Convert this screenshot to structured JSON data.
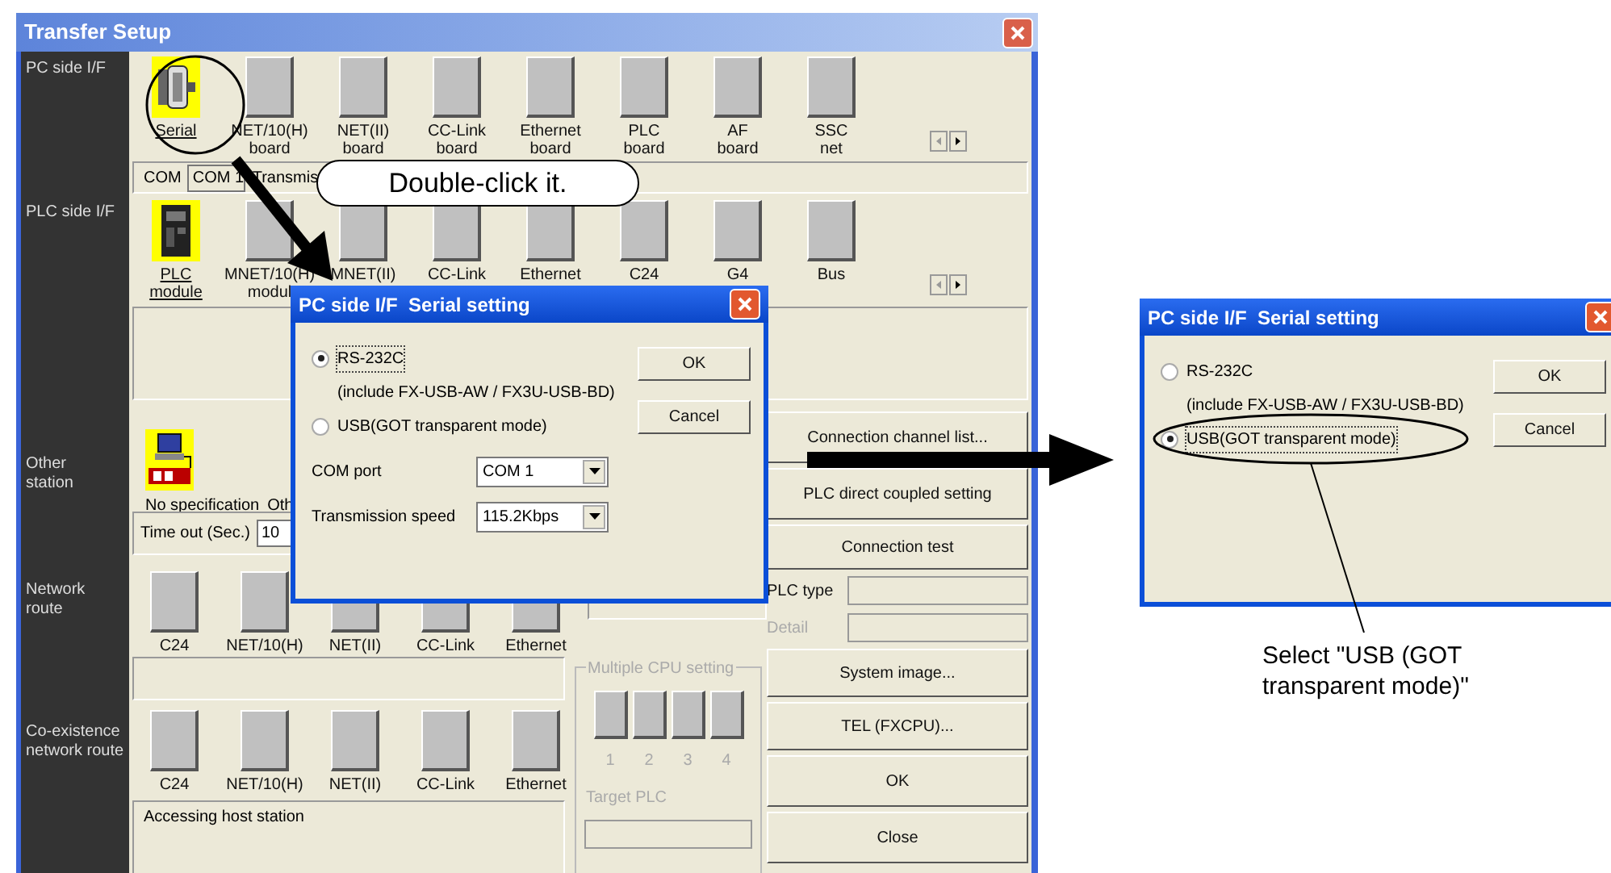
{
  "transfer_setup": {
    "title": "Transfer Setup",
    "pc_side": {
      "label": "PC side I/F",
      "items": [
        {
          "label": "Serial",
          "selected": true
        },
        {
          "label": "NET/10(H)\nboard",
          "selected": false
        },
        {
          "label": "NET(II)\nboard",
          "selected": false
        },
        {
          "label": "CC-Link\nboard",
          "selected": false
        },
        {
          "label": "Ethernet\nboard",
          "selected": false
        },
        {
          "label": "PLC\nboard",
          "selected": false
        },
        {
          "label": "AF\nboard",
          "selected": false
        },
        {
          "label": "SSC\nnet",
          "selected": false
        }
      ]
    },
    "com_bar": {
      "label": "COM",
      "value": "COM 1",
      "text": "Transmis"
    },
    "plc_side": {
      "label": "PLC side I/F",
      "items": [
        {
          "label": "PLC\nmodule",
          "selected": true
        },
        {
          "label": "MNET/10(H)\nmodul",
          "selected": false
        },
        {
          "label": "MNET(II)",
          "selected": false
        },
        {
          "label": "CC-Link",
          "selected": false
        },
        {
          "label": "Ethernet",
          "selected": false
        },
        {
          "label": "C24",
          "selected": false
        },
        {
          "label": "G4",
          "selected": false
        },
        {
          "label": "Bus",
          "selected": false
        }
      ]
    },
    "other_station": {
      "label": "Other\nstation",
      "item": {
        "label": "No specification",
        "selected": true
      },
      "text": "Oth",
      "timeout_label": "Time out (Sec.)",
      "timeout_value": "10"
    },
    "network_route": {
      "label": "Network\nroute",
      "items": [
        {
          "label": "C24",
          "selected": false
        },
        {
          "label": "NET/10(H)",
          "selected": false
        },
        {
          "label": "NET(II)",
          "selected": false
        },
        {
          "label": "CC-Link",
          "selected": false
        },
        {
          "label": "Ethernet",
          "selected": false
        }
      ]
    },
    "coexistence_route": {
      "label": "Co-existence\nnetwork route",
      "items": [
        {
          "label": "C24",
          "selected": false
        },
        {
          "label": "NET/10(H)",
          "selected": false
        },
        {
          "label": "NET(II)",
          "selected": false
        },
        {
          "label": "CC-Link",
          "selected": false
        },
        {
          "label": "Ethernet",
          "selected": false
        }
      ],
      "status": "Accessing host station"
    },
    "multiple_cpu": {
      "title": "Multiple CPU setting",
      "cpus": [
        "1",
        "2",
        "3",
        "4"
      ],
      "target_label": "Target PLC",
      "disabled": true
    },
    "plc_type": {
      "label": "PLC type",
      "disabled": false
    },
    "detail": {
      "label": "Detail",
      "disabled": true
    },
    "buttons": [
      "Connection channel list...",
      "PLC direct coupled setting",
      "Connection test",
      "System image...",
      "TEL (FXCPU)...",
      "OK",
      "Close"
    ]
  },
  "dialogs": [
    {
      "title": "PC side I/F  Serial setting",
      "options": [
        {
          "label": "RS-232C",
          "selected": true
        },
        {
          "label": "USB(GOT transparent mode)",
          "selected": false
        }
      ],
      "note": "(include FX-USB-AW / FX3U-USB-BD)",
      "fields": [
        {
          "label": "COM port",
          "value": "COM 1"
        },
        {
          "label": "Transmission speed",
          "value": "115.2Kbps"
        }
      ],
      "buttons": [
        "OK",
        "Cancel"
      ]
    },
    {
      "title": "PC side I/F  Serial setting",
      "options": [
        {
          "label": "RS-232C",
          "selected": false
        },
        {
          "label": "USB(GOT transparent mode)",
          "selected": true
        }
      ],
      "note": "(include FX-USB-AW / FX3U-USB-BD)",
      "buttons": [
        "OK",
        "Cancel"
      ]
    }
  ],
  "callouts": {
    "double_click": "Double-click it.",
    "select": "Select \"USB (GOT transparent mode)\""
  }
}
